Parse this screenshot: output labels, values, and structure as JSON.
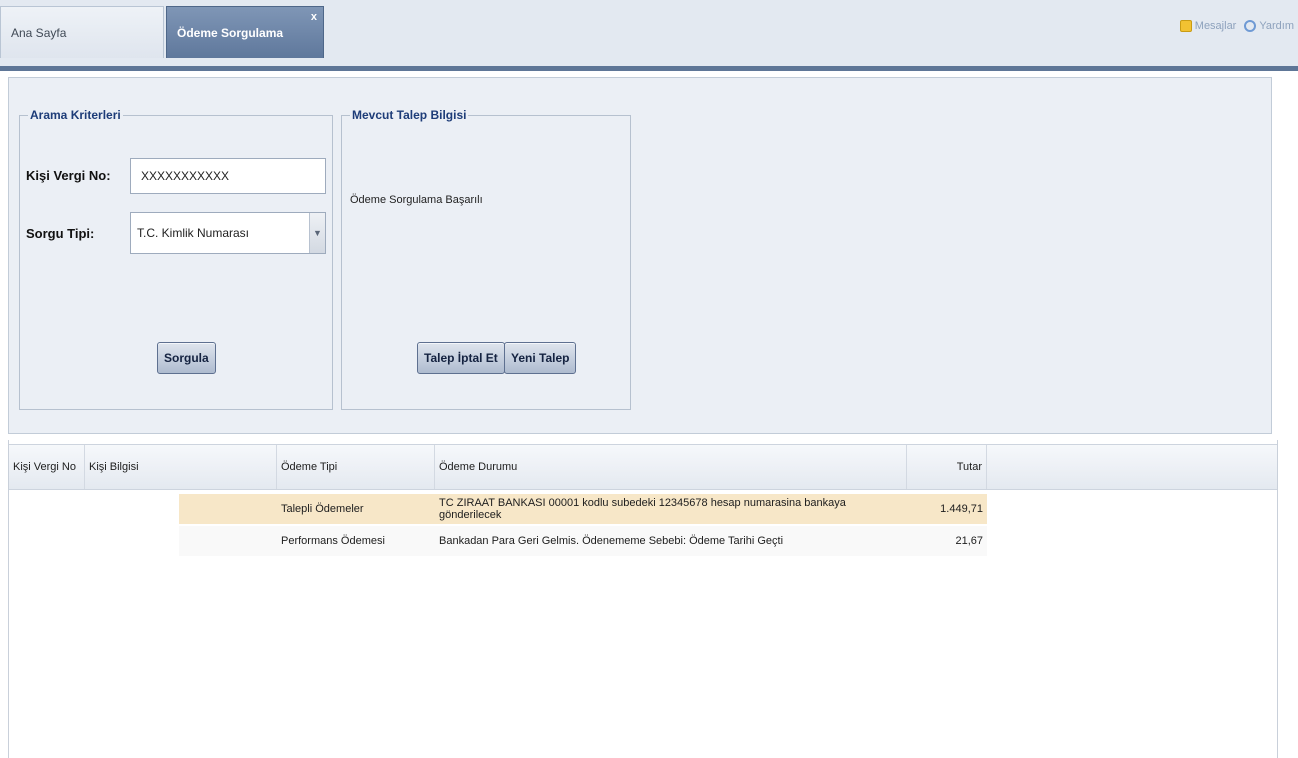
{
  "tabs": {
    "home": "Ana Sayfa",
    "active": "Ödeme Sorgulama",
    "close": "x"
  },
  "top_actions": {
    "messages": "Mesajlar",
    "help": "Yardım"
  },
  "search_criteria": {
    "legend": "Arama Kriterleri",
    "tax_no_label": "Kişi Vergi No:",
    "tax_no_value": "XXXXXXXXXXX",
    "query_type_label": "Sorgu Tipi:",
    "query_type_value": "T.C. Kimlik Numarası",
    "query_button": "Sorgula"
  },
  "request_info": {
    "legend": "Mevcut Talep Bilgisi",
    "status": "Ödeme Sorgulama Başarılı",
    "cancel_button": "Talep İptal Et",
    "new_button": "Yeni Talep"
  },
  "results": {
    "columns": [
      "Kişi Vergi No",
      "Kişi Bilgisi",
      "Ödeme Tipi",
      "Ödeme Durumu",
      "Tutar"
    ],
    "rows": [
      {
        "tax_no": "",
        "person": "",
        "type": "Talepli Ödemeler",
        "status": "TC ZIRAAT BANKASI 00001 kodlu subedeki 12345678 hesap numarasina bankaya gönderilecek",
        "amount": "1.449,71"
      },
      {
        "tax_no": "",
        "person": "",
        "type": "Performans Ödemesi",
        "status": "Bankadan Para Geri Gelmis. Ödenememe Sebebi: Ödeme Tarihi Geçti",
        "amount": "21,67"
      }
    ]
  },
  "colors": {
    "active_tab": "#6b84a8",
    "legend_text": "#1d3c78",
    "selected_row": "#f7e7c8"
  }
}
